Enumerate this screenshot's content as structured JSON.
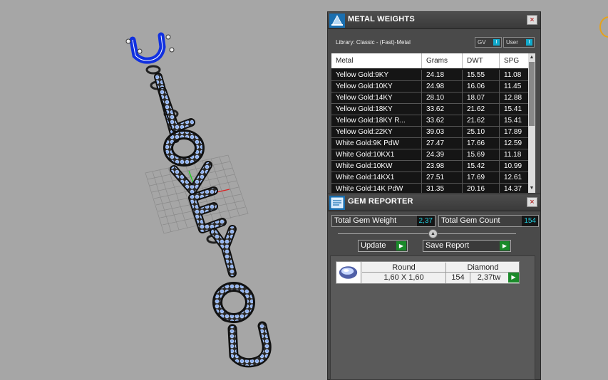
{
  "metal_weights": {
    "title": "METAL WEIGHTS",
    "close": "×",
    "library_label": "Library: Classic - (Fast)-Metal",
    "toggle_gv": "GV",
    "toggle_user": "User",
    "toggle_knob": "I",
    "columns": [
      "Metal",
      "Grams",
      "DWT",
      "SPG"
    ],
    "rows": [
      [
        "Yellow Gold:9KY",
        "24.18",
        "15.55",
        "11.08"
      ],
      [
        "Yellow Gold:10KY",
        "24.98",
        "16.06",
        "11.45"
      ],
      [
        "Yellow Gold:14KY",
        "28.10",
        "18.07",
        "12.88"
      ],
      [
        "Yellow Gold:18KY",
        "33.62",
        "21.62",
        "15.41"
      ],
      [
        "Yellow Gold:18KY R...",
        "33.62",
        "21.62",
        "15.41"
      ],
      [
        "Yellow Gold:22KY",
        "39.03",
        "25.10",
        "17.89"
      ],
      [
        "White Gold:9K PdW",
        "27.47",
        "17.66",
        "12.59"
      ],
      [
        "White Gold:10KX1",
        "24.39",
        "15.69",
        "11.18"
      ],
      [
        "White Gold:10KW",
        "23.98",
        "15.42",
        "10.99"
      ],
      [
        "White Gold:14KX1",
        "27.51",
        "17.69",
        "12.61"
      ],
      [
        "White Gold:14K PdW",
        "31.35",
        "20.16",
        "14.37"
      ]
    ]
  },
  "gem_reporter": {
    "title": "GEM REPORTER",
    "close": "×",
    "total_weight_label": "Total Gem Weight",
    "total_weight_value": "2,37",
    "total_count_label": "Total Gem Count",
    "total_count_value": "154",
    "update_label": "Update",
    "save_label": "Save Report",
    "gem": {
      "shape": "Round",
      "size": "1,60 X 1,60",
      "material": "Diamond",
      "count": "154",
      "weight": "2,37tw"
    }
  },
  "colors": {
    "viewport_bg": "#a6a6a6",
    "panel_bg": "#4a4a4a",
    "gem_dot": "#8fb2f0",
    "accent_cyan": "#22ccdd",
    "selected_blue": "#1030e0"
  },
  "icons": [
    "metal-weights-icon",
    "gem-reporter-icon",
    "close-icon",
    "play-icon",
    "round-gem-icon",
    "scroll-up-icon",
    "scroll-down-icon"
  ]
}
